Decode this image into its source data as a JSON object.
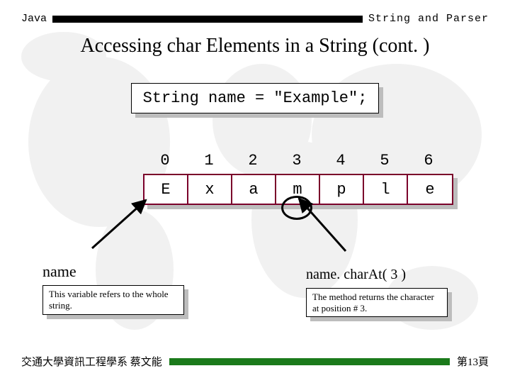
{
  "header": {
    "left": "Java",
    "right": "String and Parser"
  },
  "title": "Accessing char Elements in a String (cont. )",
  "code": "String name = \"Example\";",
  "array": {
    "indices": [
      "0",
      "1",
      "2",
      "3",
      "4",
      "5",
      "6"
    ],
    "chars": [
      "E",
      "x",
      "a",
      "m",
      "p",
      "l",
      "e"
    ]
  },
  "name_label": "name",
  "caption_left": "This variable refers to the whole string.",
  "charAt_label": "name. charAt( 3 )",
  "caption_right": "The method returns the character at position # 3.",
  "footer": {
    "left": "交通大學資訊工程學系 蔡文能",
    "right": "第13頁"
  }
}
